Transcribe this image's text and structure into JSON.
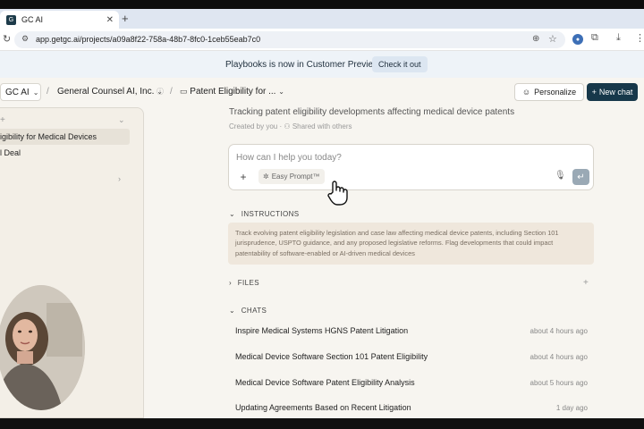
{
  "browser": {
    "tab_title": "GC AI",
    "tab_favicon_letter": "G",
    "close_glyph": "✕",
    "new_tab_glyph": "+",
    "url": "app.getgc.ai/projects/a09a8f22-758a-48b7-8fc0-1ceb55eab7c0",
    "icons": [
      "reload-icon",
      "site-info-icon",
      "zoom-icon",
      "star-icon",
      "profile-icon",
      "extensions-icon",
      "download-icon",
      "menu-icon"
    ]
  },
  "banner": {
    "text": "Playbooks is now in Customer Preview",
    "button": "Check it out"
  },
  "breadcrumb": {
    "workspace": "GC AI",
    "company": "General Counsel AI, Inc.",
    "project": "Patent Eligibility for ..."
  },
  "header_actions": {
    "personalize": "Personalize",
    "new_chat": "New chat"
  },
  "sidebar": {
    "items": [
      {
        "label": "igibility for Medical Devices",
        "active": true
      },
      {
        "label": "l Deal",
        "active": false
      }
    ]
  },
  "project": {
    "description": "Tracking patent eligibility developments affecting medical device patents",
    "created_by": "Created by you",
    "separator": "·",
    "shared": "Shared with others"
  },
  "prompt": {
    "placeholder": "How can I help you today?",
    "easy_prompt": "Easy Prompt™"
  },
  "sections": {
    "instructions": "INSTRUCTIONS",
    "files": "FILES",
    "chats": "CHATS"
  },
  "instructions_text": "Track evolving patent eligibility legislation and case law affecting medical device patents, including Section 101 jurisprudence, USPTO guidance, and any proposed legislative reforms. Flag developments that could impact patentability of software-enabled or AI-driven medical devices",
  "chats": [
    {
      "title": "Inspire Medical Systems HGNS Patent Litigation",
      "time": "about 4 hours ago"
    },
    {
      "title": "Medical Device Software Section 101 Patent Eligibility",
      "time": "about 4 hours ago"
    },
    {
      "title": "Medical Device Software Patent Eligibility Analysis",
      "time": "about 5 hours ago"
    },
    {
      "title": "Updating Agreements Based on Recent Litigation",
      "time": "1 day ago"
    }
  ],
  "colors": {
    "accent_dark": "#17384a",
    "banner_bg": "#eef3f8",
    "instructions_bg": "#efe7dc",
    "page_bg": "#f7f5f0"
  }
}
